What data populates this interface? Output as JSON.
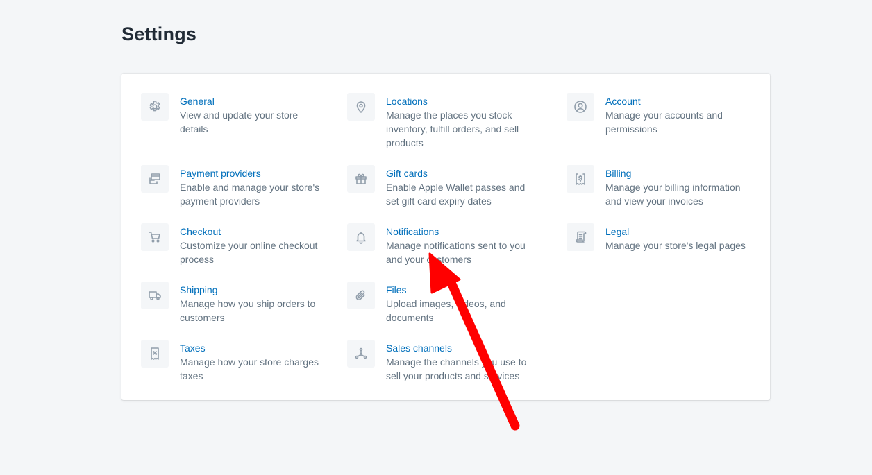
{
  "page": {
    "title": "Settings"
  },
  "items": [
    {
      "id": "general",
      "title": "General",
      "description": "View and update your store details",
      "icon": "gear-icon"
    },
    {
      "id": "locations",
      "title": "Locations",
      "description": "Manage the places you stock inventory, fulfill orders, and sell products",
      "icon": "location-pin-icon"
    },
    {
      "id": "account",
      "title": "Account",
      "description": "Manage your accounts and permissions",
      "icon": "user-circle-icon"
    },
    {
      "id": "payment-providers",
      "title": "Payment providers",
      "description": "Enable and manage your store's payment providers",
      "icon": "credit-card-icon"
    },
    {
      "id": "gift-cards",
      "title": "Gift cards",
      "description": "Enable Apple Wallet passes and set gift card expiry dates",
      "icon": "gift-icon"
    },
    {
      "id": "billing",
      "title": "Billing",
      "description": "Manage your billing information and view your invoices",
      "icon": "billing-receipt-icon"
    },
    {
      "id": "checkout",
      "title": "Checkout",
      "description": "Customize your online checkout process",
      "icon": "cart-icon"
    },
    {
      "id": "notifications",
      "title": "Notifications",
      "description": "Manage notifications sent to you and your customers",
      "icon": "bell-icon"
    },
    {
      "id": "legal",
      "title": "Legal",
      "description": "Manage your store's legal pages",
      "icon": "legal-scroll-icon"
    },
    {
      "id": "shipping",
      "title": "Shipping",
      "description": "Manage how you ship orders to customers",
      "icon": "truck-icon"
    },
    {
      "id": "files",
      "title": "Files",
      "description": "Upload images, videos, and documents",
      "icon": "paperclip-icon"
    },
    {
      "id": "taxes",
      "title": "Taxes",
      "description": "Manage how your store charges taxes",
      "icon": "tax-receipt-icon"
    },
    {
      "id": "sales-channels",
      "title": "Sales channels",
      "description": "Manage the channels you use to sell your products and services",
      "icon": "channels-icon"
    }
  ],
  "annotation": {
    "type": "arrow",
    "color": "#ff0000",
    "points_to": "notifications"
  }
}
